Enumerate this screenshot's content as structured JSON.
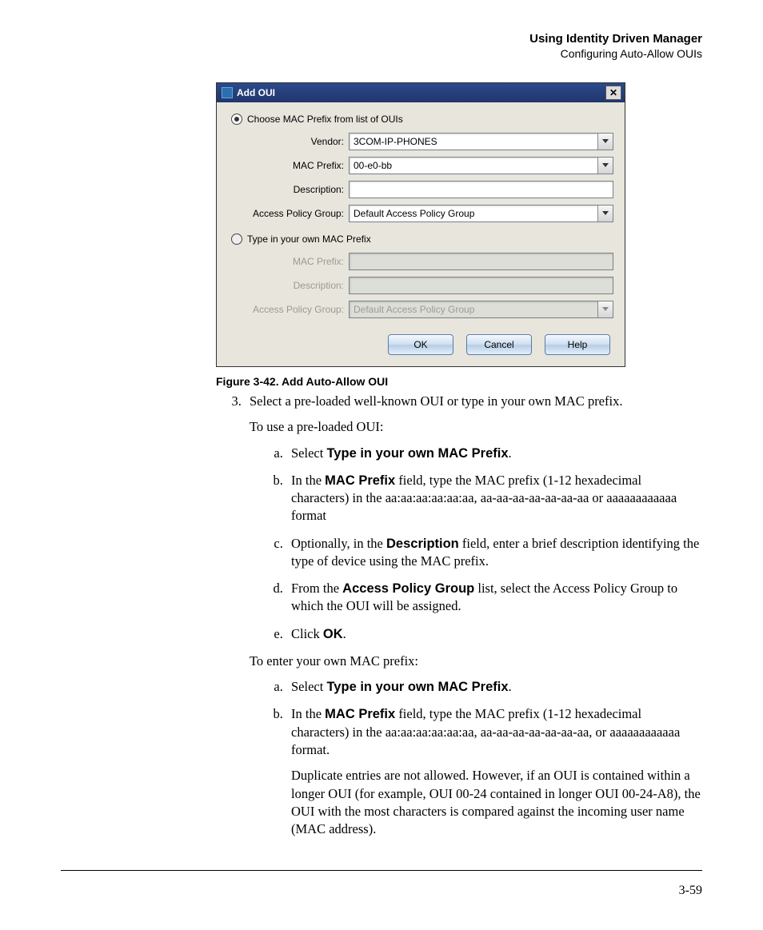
{
  "header": {
    "title": "Using Identity Driven Manager",
    "subtitle": "Configuring Auto-Allow OUIs"
  },
  "dialog": {
    "title": "Add OUI",
    "radio1": "Choose MAC Prefix from list of OUIs",
    "radio2": "Type in your own MAC Prefix",
    "labels": {
      "vendor": "Vendor:",
      "mac_prefix": "MAC Prefix:",
      "description": "Description:",
      "apg": "Access Policy Group:"
    },
    "values": {
      "vendor": "3COM-IP-PHONES",
      "mac_prefix": "00-e0-bb",
      "description": "",
      "apg": "Default Access Policy Group",
      "mac_prefix2": "",
      "description2": "",
      "apg2": "Default Access Policy Group"
    },
    "buttons": {
      "ok": "OK",
      "cancel": "Cancel",
      "help": "Help"
    }
  },
  "caption": "Figure 3-42. Add Auto-Allow OUI",
  "step3": {
    "num": "3.",
    "text": "Select a pre-loaded well-known OUI or type in your own MAC prefix.",
    "use_preloaded": "To use a pre-loaded OUI:",
    "a1": "Select ",
    "a1b": "Type in your own MAC Prefix",
    "a1c": ".",
    "b1a": "In the ",
    "b1b": "MAC Prefix",
    "b1c": " field, type the MAC prefix (1-12 hexadecimal characters) in the aa:aa:aa:aa:aa:aa, aa-aa-aa-aa-aa-aa-aa or aaaaaaaaaaaa format",
    "c1a": "Optionally, in the ",
    "c1b": "Description",
    "c1c": " field, enter a brief description identifying the type of device using the MAC prefix.",
    "d1a": "From the ",
    "d1b": "Access Policy Group",
    "d1c": " list, select the Access Policy Group to which the OUI will be assigned.",
    "e1a": "Click ",
    "e1b": "OK",
    "e1c": ".",
    "enter_own": "To enter your own MAC prefix:",
    "a2": "Select ",
    "a2b": "Type in your own MAC Prefix",
    "a2c": ".",
    "b2a": "In the ",
    "b2b": "MAC Prefix",
    "b2c": " field, type the MAC prefix (1-12 hexadecimal characters) in the aa:aa:aa:aa:aa:aa, aa-aa-aa-aa-aa-aa-aa, or aaaaaaaaaaaa format.",
    "dup": "Duplicate entries are not allowed. However, if an OUI is contained within a longer OUI (for example, OUI 00-24 contained in longer OUI 00-24-A8), the OUI with the most characters is compared against the incoming user name (MAC address)."
  },
  "pagenum": "3-59"
}
